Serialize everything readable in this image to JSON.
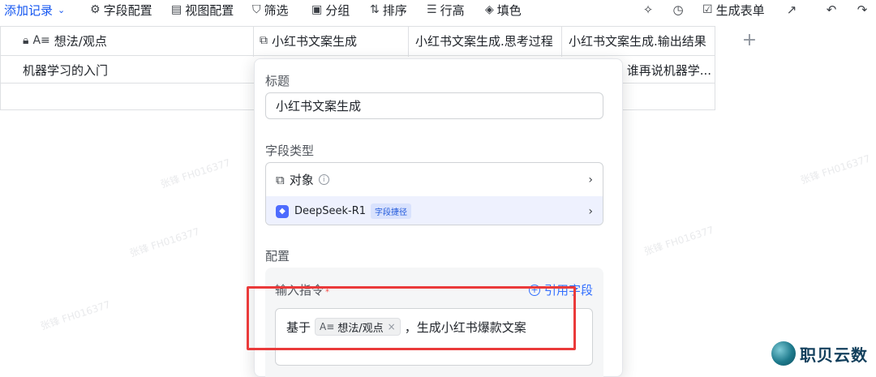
{
  "toolbar": {
    "add_record": "添加记录",
    "field_config": "字段配置",
    "view_config": "视图配置",
    "filter": "筛选",
    "group": "分组",
    "sort": "排序",
    "row_height": "行高",
    "fill": "填色",
    "generate_form": "生成表单"
  },
  "icons": {
    "caret": "chevron-down-icon",
    "field_config": "gear-icon",
    "view_config": "view-icon",
    "filter": "filter-icon",
    "group": "group-icon",
    "sort": "sort-icon",
    "row_height": "row-height-icon",
    "fill": "fill-icon",
    "sparkle": "sparkle-icon",
    "history": "history-icon",
    "form": "form-icon",
    "share": "share-icon",
    "undo": "undo-icon",
    "redo": "redo-icon"
  },
  "table": {
    "columns": [
      "想法/观点",
      "小红书文案生成",
      "小红书文案生成.思考过程",
      "小红书文案生成.输出结果"
    ],
    "rows": [
      [
        "机器学习的入门",
        "",
        "",
        "谁再说机器学..."
      ]
    ]
  },
  "watermark": "张锋 FH016377",
  "panel": {
    "title_label": "标题",
    "title_value": "小红书文案生成",
    "field_type_label": "字段类型",
    "type_object": "对象",
    "type_model": "DeepSeek-R1",
    "type_tag": "字段捷径",
    "config_label": "配置",
    "instruction_label": "输入指令",
    "required_mark": "*",
    "reference_field": "引用字段",
    "prompt_prefix": "基于",
    "prompt_chip": "想法/观点",
    "prompt_suffix": "，生成小红书爆款文案"
  },
  "brand": {
    "name": "职贝云数"
  },
  "colors": {
    "accent": "#1456f0",
    "link": "#3370ff",
    "highlight": "#ea3a3a",
    "selected_row": "#eef1fe"
  }
}
